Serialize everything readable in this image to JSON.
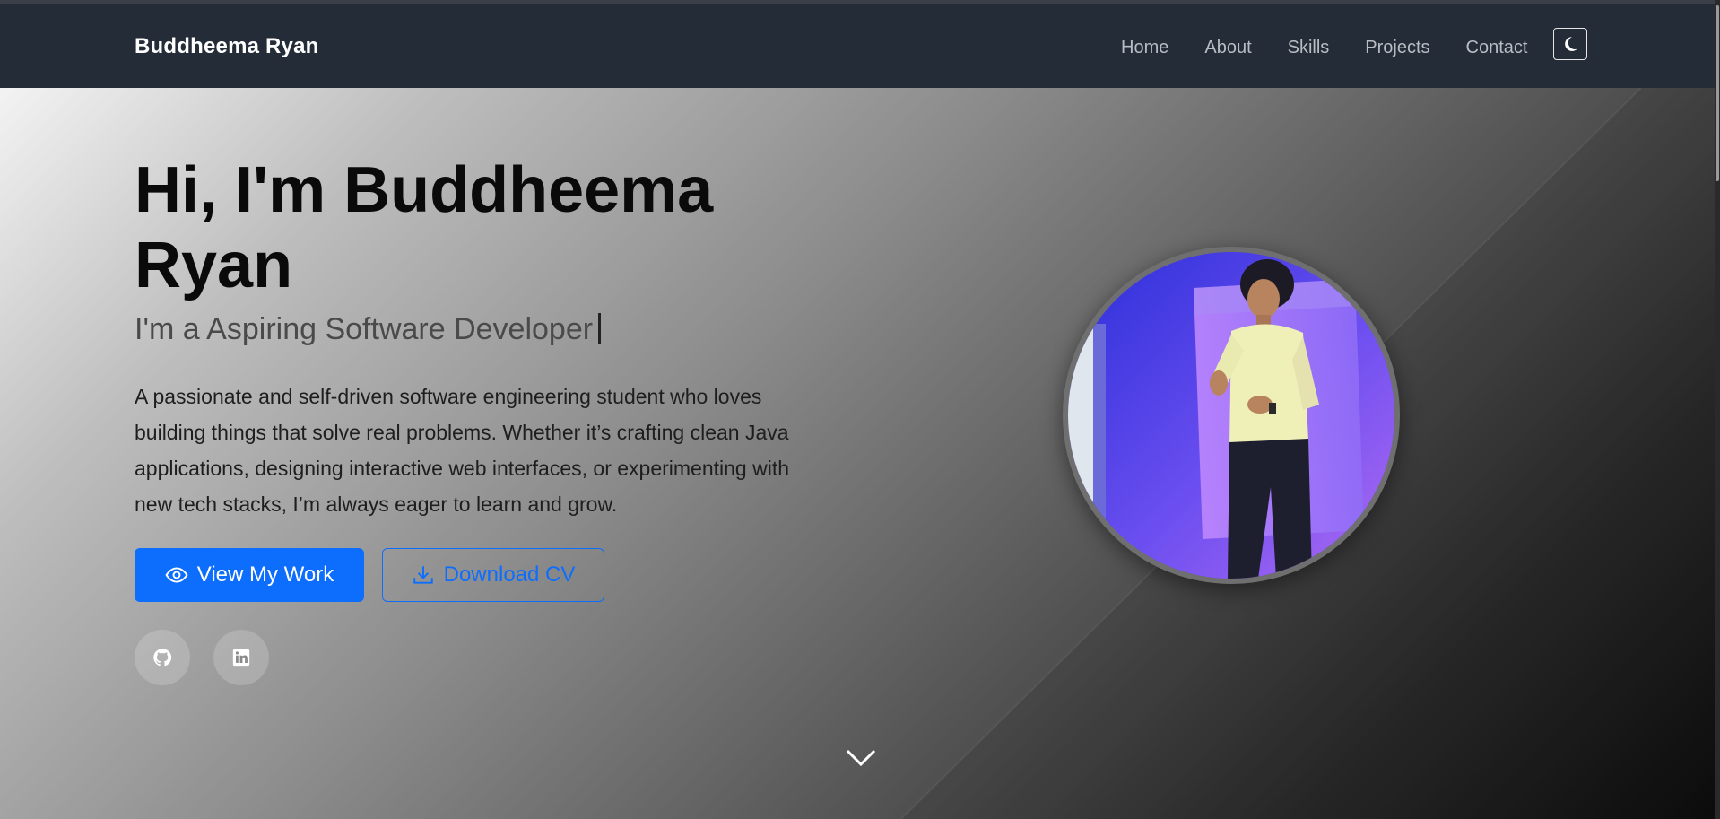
{
  "navbar": {
    "brand": "Buddheema Ryan",
    "links": [
      "Home",
      "About",
      "Skills",
      "Projects",
      "Contact"
    ],
    "theme_toggle_icon": "moon-icon"
  },
  "hero": {
    "title_line1": "Hi, I'm Buddheema",
    "title_line2": "Ryan",
    "subtitle": "I'm a Aspiring Software Developer",
    "description": "A passionate and self-driven software engineering student who loves building things that solve real problems. Whether it’s crafting clean Java applications, designing interactive web interfaces, or experimenting with new tech stacks, I’m always eager to learn and grow.",
    "primary_button": "View My Work",
    "primary_button_icon": "eye-icon",
    "secondary_button": "Download CV",
    "secondary_button_icon": "download-icon",
    "social": [
      {
        "icon": "github-icon"
      },
      {
        "icon": "linkedin-icon"
      }
    ],
    "scroll_icon": "chevron-down-icon"
  },
  "colors": {
    "navbar_bg": "#242c37",
    "accent": "#0d6efd"
  }
}
